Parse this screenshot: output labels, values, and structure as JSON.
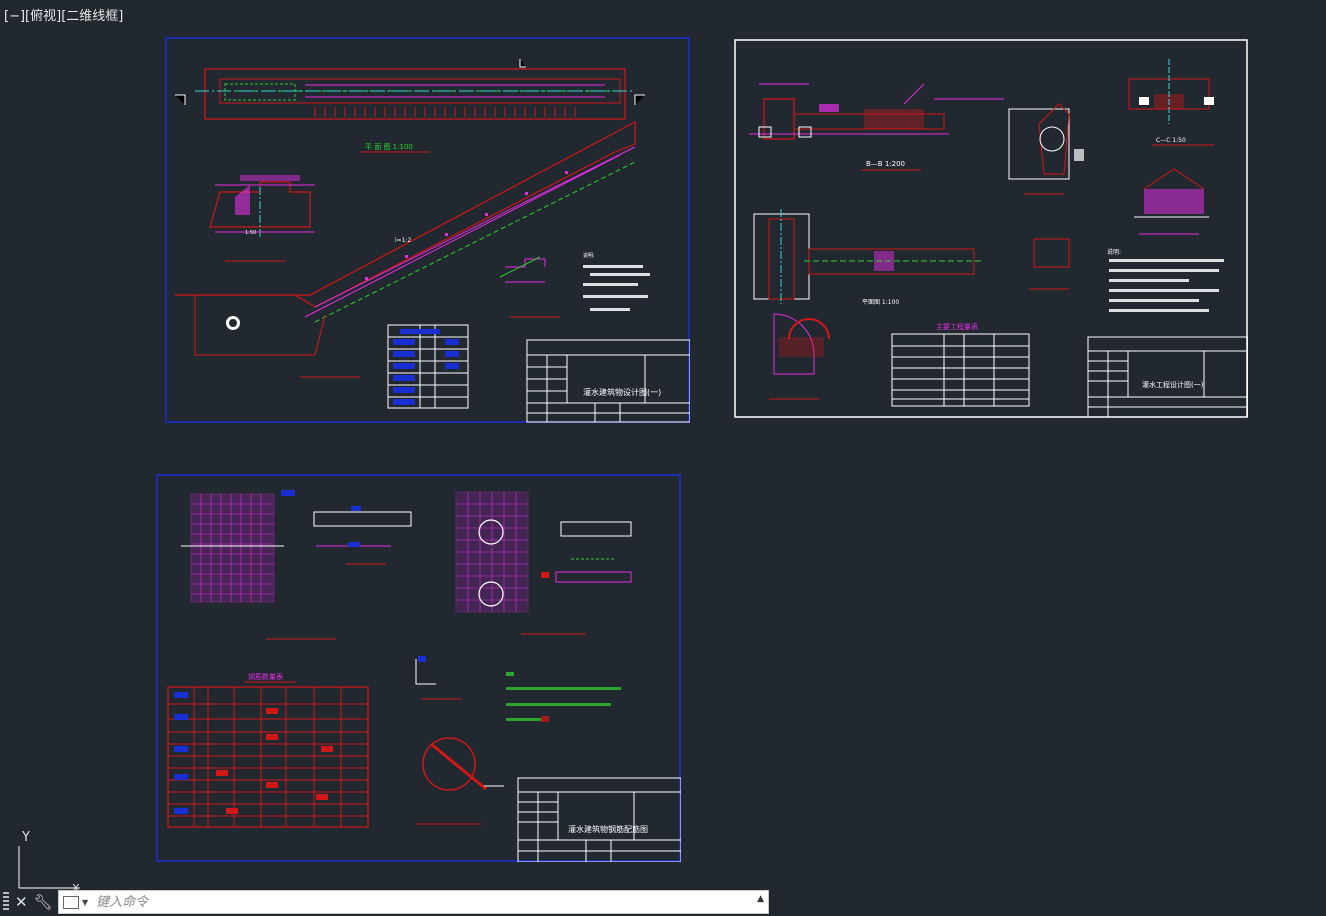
{
  "viewport": {
    "bracket_minus": "[−]",
    "view": "[俯视]",
    "style": "[二维线框]"
  },
  "ucs": {
    "y_label": "Y",
    "x_label": "X"
  },
  "command_line": {
    "placeholder": "键入命令"
  },
  "sheets": {
    "sheet1": {
      "title": "灌水建筑物设计图(一)",
      "notes_title": "说明:",
      "section_label": "A—A 1:100",
      "scale_label": "1:100"
    },
    "sheet2": {
      "title": "灌水工程设计图(一)",
      "notes_title": "说明:",
      "section_bb": "B—B 1:200",
      "plan_label": "平面图 1:100",
      "section_cc": "C—C 1:50",
      "section_dd": "D—D 1:50",
      "table_title": "主要工程量表"
    },
    "sheet3": {
      "title": "灌水建筑物钢筋配筋图",
      "table_title": "钢筋数量表"
    }
  },
  "colors": {
    "background": "#212830",
    "frame_blue": "#1a2fd1",
    "frame_white": "#ffffff",
    "red": "#d11717",
    "magenta": "#e22ee2",
    "green": "#2ecf2e",
    "cyan": "#36d6d6",
    "yellow": "#e0d040"
  }
}
